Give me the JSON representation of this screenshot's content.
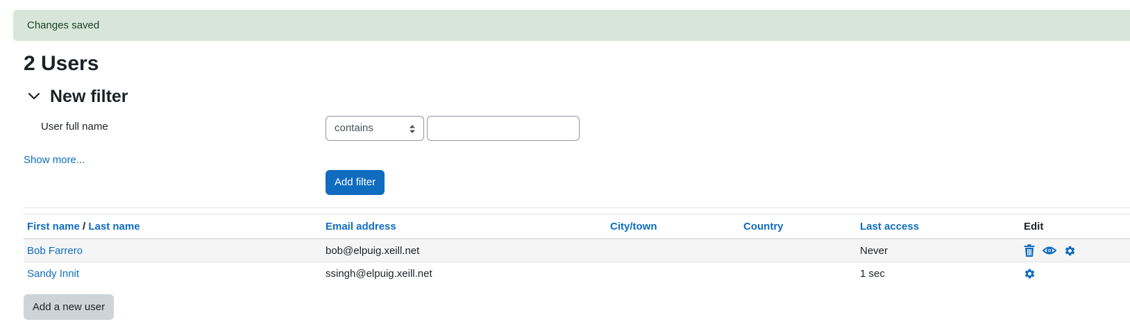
{
  "alert": {
    "text": "Changes saved"
  },
  "page_title": "2 Users",
  "filter": {
    "title": "New filter",
    "field_label": "User full name",
    "operator_selected": "contains",
    "value": "",
    "show_more": "Show more...",
    "add_button": "Add filter"
  },
  "table": {
    "headers": {
      "first_name": "First name",
      "name_sep": "/",
      "last_name": "Last name",
      "email": "Email address",
      "city": "City/town",
      "country": "Country",
      "last_access": "Last access",
      "edit": "Edit"
    },
    "rows": [
      {
        "name": "Bob Farrero",
        "email": "bob@elpuig.xeill.net",
        "city": "",
        "country": "",
        "last_access": "Never",
        "icons": [
          "trash-icon",
          "eye-icon",
          "gear-icon"
        ]
      },
      {
        "name": "Sandy Innit",
        "email": "ssingh@elpuig.xeill.net",
        "city": "",
        "country": "",
        "last_access": "1 sec",
        "icons": [
          "gear-icon"
        ]
      }
    ]
  },
  "add_user_button": "Add a new user",
  "colors": {
    "link": "#0f6cbf",
    "alert_bg": "#d7e6d9",
    "primary_button": "#0f6cbf",
    "secondary_button": "#ced4da"
  }
}
